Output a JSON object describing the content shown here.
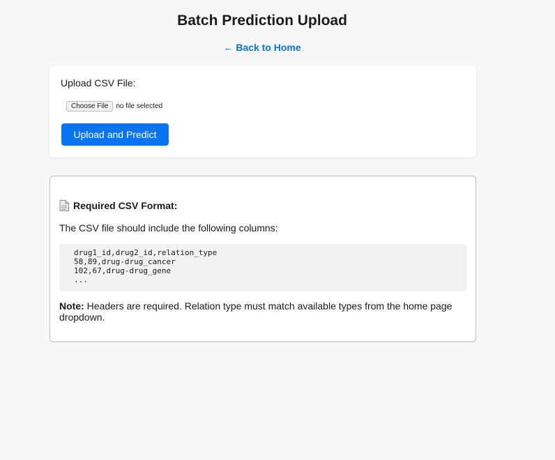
{
  "header": {
    "title": "Batch Prediction Upload",
    "back_link": "← Back to Home"
  },
  "upload": {
    "label": "Upload CSV File:",
    "choose_file": "Choose File",
    "file_status": "no file selected",
    "submit_label": "Upload and Predict"
  },
  "format": {
    "icon": "document-icon",
    "heading": "Required CSV Format:",
    "intro": "The CSV file should include the following columns:",
    "code_lines": [
      "drug1_id,drug2_id,relation_type",
      "58,89,drug-drug_cancer",
      "102,67,drug-drug_gene",
      "..."
    ],
    "note_label": "Note:",
    "note_text": " Headers are required. Relation type must match available types from the home page dropdown."
  },
  "colors": {
    "accent": "#0a74f0",
    "link": "#0a74d9",
    "background": "#f7f7f7"
  }
}
